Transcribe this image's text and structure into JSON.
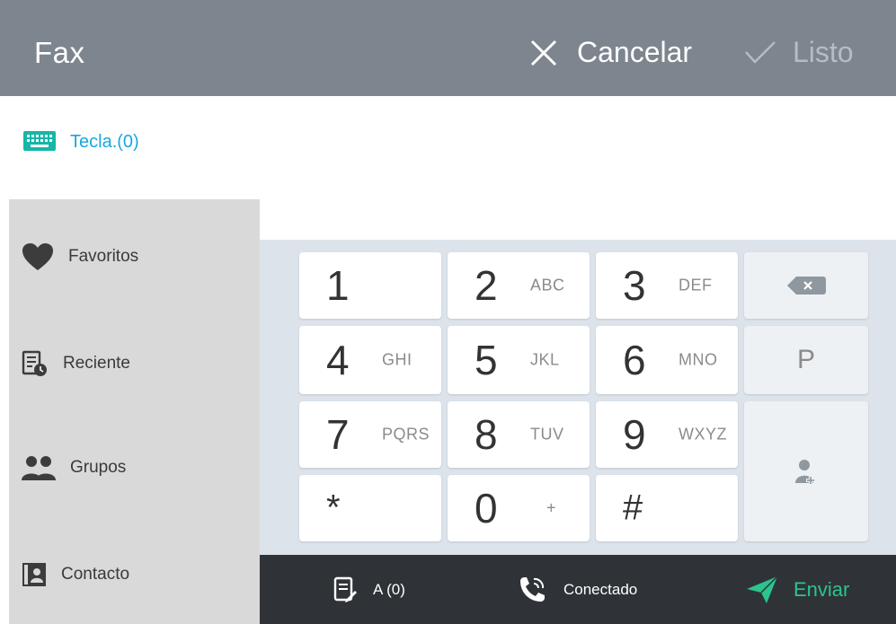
{
  "header": {
    "title": "Fax",
    "cancel_label": "Cancelar",
    "done_label": "Listo"
  },
  "tabs": {
    "keypad_label": "Tecla.(0)"
  },
  "sidebar": {
    "items": [
      {
        "label": "Favoritos",
        "icon": "heart-icon"
      },
      {
        "label": "Reciente",
        "icon": "recent-icon"
      },
      {
        "label": "Grupos",
        "icon": "groups-icon"
      },
      {
        "label": "Contacto",
        "icon": "contact-icon"
      }
    ]
  },
  "keypad": {
    "keys": [
      {
        "digit": "1",
        "letters": ""
      },
      {
        "digit": "2",
        "letters": "ABC"
      },
      {
        "digit": "3",
        "letters": "DEF"
      },
      {
        "digit": "4",
        "letters": "GHI"
      },
      {
        "digit": "5",
        "letters": "JKL"
      },
      {
        "digit": "6",
        "letters": "MNO"
      },
      {
        "digit": "7",
        "letters": "PQRS"
      },
      {
        "digit": "8",
        "letters": "TUV"
      },
      {
        "digit": "9",
        "letters": "WXYZ"
      },
      {
        "digit": "*",
        "letters": ""
      },
      {
        "digit": "0",
        "letters": "+"
      },
      {
        "digit": "#",
        "letters": ""
      }
    ],
    "pause_label": "P"
  },
  "bottom": {
    "to_label": "A (0)",
    "connected_label": "Conectado",
    "send_label": "Enviar"
  },
  "colors": {
    "header_bg": "#7d858e",
    "accent_blue": "#1aa7df",
    "send_green": "#2bc48d",
    "bottom_bar_bg": "#2f3338"
  }
}
